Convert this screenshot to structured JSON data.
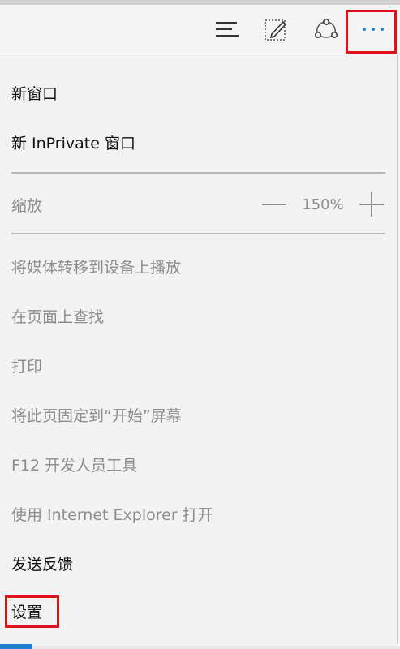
{
  "colors": {
    "highlight": "#e0101c",
    "accent": "#1e7fd8",
    "text": "#111111",
    "disabled_text": "#8c8c8c"
  },
  "toolbar": {
    "icons": [
      "hub-icon",
      "web-note-icon",
      "share-icon",
      "more-icon"
    ],
    "more_label": "···"
  },
  "menu": {
    "new_window": "新窗口",
    "new_inprivate": "新 InPrivate 窗口",
    "zoom": {
      "label": "缩放",
      "value": "150%"
    },
    "cast": "将媒体转移到设备上播放",
    "find": "在页面上查找",
    "print": "打印",
    "pin": "将此页固定到“开始”屏幕",
    "devtools": "F12 开发人员工具",
    "open_ie": "使用 Internet Explorer 打开",
    "feedback": "发送反馈",
    "settings": "设置"
  }
}
